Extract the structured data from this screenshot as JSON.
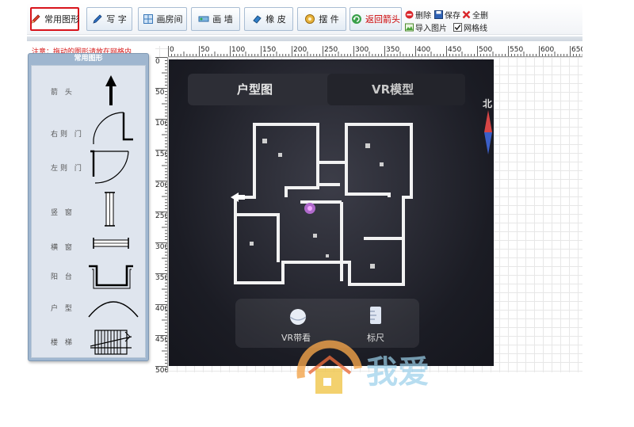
{
  "toolbar": {
    "buttons": [
      {
        "label": "常用图形",
        "icon": "pencil-icon"
      },
      {
        "label": "写 字",
        "icon": "pen-icon"
      },
      {
        "label": "画房间",
        "icon": "room-icon"
      },
      {
        "label": "画 墙",
        "icon": "wall-icon"
      },
      {
        "label": "橡 皮",
        "icon": "eraser-icon"
      },
      {
        "label": "摆 件",
        "icon": "furniture-icon"
      },
      {
        "label": "返回箭头",
        "icon": "return-arrow-icon"
      }
    ],
    "delete_label": "删除",
    "save_label": "保存",
    "clear_all_label": "全删",
    "import_image_label": "导入图片",
    "gridlines_label": "网格线",
    "gridlines_checked": true
  },
  "notice": "注意：拖动的图形请放在网格内",
  "panel": {
    "title": "常用图形",
    "shapes": [
      {
        "label": "箭 头",
        "icon": "arrow-shape-icon"
      },
      {
        "label": "右则 门",
        "icon": "right-door-icon"
      },
      {
        "label": "左则 门",
        "icon": "left-door-icon"
      },
      {
        "label": "竖 窗",
        "icon": "vertical-window-icon"
      },
      {
        "label": "横 窗",
        "icon": "horizontal-window-icon"
      },
      {
        "label": "阳 台",
        "icon": "balcony-icon"
      },
      {
        "label": "户 型",
        "icon": "floor-arc-icon"
      },
      {
        "label": "楼 梯",
        "icon": "stairs-icon"
      }
    ]
  },
  "ruler": {
    "top_ticks": [
      "0",
      "50",
      "100",
      "150",
      "200",
      "250",
      "300",
      "350",
      "400",
      "450",
      "500",
      "550",
      "600",
      "650"
    ],
    "left_ticks": [
      "0",
      "50",
      "100",
      "150",
      "200",
      "250",
      "300",
      "350",
      "400",
      "450",
      "500"
    ]
  },
  "image": {
    "tab_floorplan": "户型图",
    "tab_vr": "VR模型",
    "compass": "北",
    "btn_vr": "VR带看",
    "btn_ruler": "标尺",
    "watermark_text": "我爱"
  },
  "colors": {
    "accent_red": "#d8141c",
    "toolbar_border": "#a9bdd3",
    "panel_frame": "#9fb6cf"
  }
}
